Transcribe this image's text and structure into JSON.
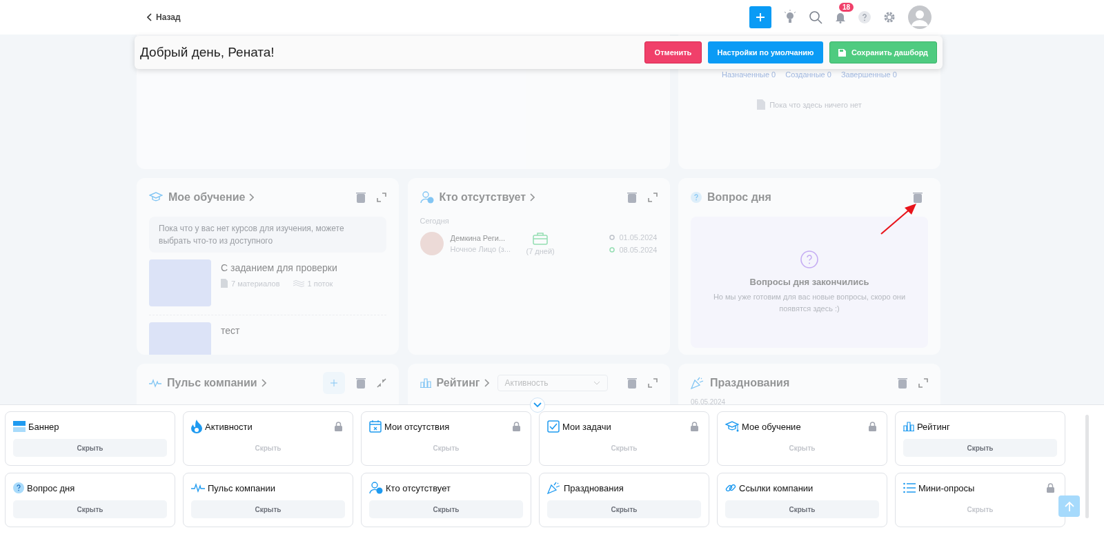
{
  "header": {
    "back_label": "Назад",
    "notifications_count": "18"
  },
  "greeting_bar": {
    "text": "Добрый день, Рената!",
    "buttons": [
      {
        "label": "Отменить",
        "kind": "danger"
      },
      {
        "label": "Настройки по умолчанию",
        "kind": "primary"
      },
      {
        "label": "Сохранить дашборд",
        "kind": "success"
      }
    ]
  },
  "tasks_card": {
    "tabs": [
      {
        "label": "Назначенные",
        "count": "0"
      },
      {
        "label": "Созданные",
        "count": "0"
      },
      {
        "label": "Завершенные",
        "count": "0"
      }
    ],
    "empty_text": "Пока что здесь ничего нет"
  },
  "learning_card": {
    "title": "Мое обучение",
    "info_text": "Пока что у вас нет курсов для изучения, можете выбрать что-то из доступного",
    "courses": [
      {
        "title": "С заданием для проверки",
        "materials": "7 материалов",
        "streams": "1 поток"
      },
      {
        "title": "тест"
      }
    ]
  },
  "absence_card": {
    "title": "Кто отсутствует",
    "section_label": "Сегодня",
    "entries": [
      {
        "name": "Демкина Реги...",
        "subtitle": "Ночное Лицо (з...",
        "duration": "(7 дней)",
        "start_date": "01.05.2024",
        "end_date": "08.05.2024"
      }
    ]
  },
  "question_card": {
    "title": "Вопрос дня",
    "empty_title": "Вопросы дня закончились",
    "empty_text": "Но мы уже готовим для вас новые вопросы, скоро они появятся здесь :)"
  },
  "pulse_card": {
    "title": "Пульс компании"
  },
  "rating_card": {
    "title": "Рейтинг",
    "select_value": "Активность"
  },
  "celebrations_card": {
    "title": "Празднования",
    "date": "06.05.2024"
  },
  "widget_panel": {
    "widgets": [
      {
        "title": "Баннер",
        "kind": "banner",
        "locked": false,
        "button_label": "Скрыть"
      },
      {
        "title": "Активности",
        "kind": "fire",
        "locked": true,
        "button_label": "Скрыть"
      },
      {
        "title": "Мои отсутствия",
        "kind": "calendar",
        "locked": true,
        "button_label": "Скрыть"
      },
      {
        "title": "Мои задачи",
        "kind": "check",
        "locked": true,
        "button_label": "Скрыть"
      },
      {
        "title": "Мое обучение",
        "kind": "cap",
        "locked": true,
        "button_label": "Скрыть"
      },
      {
        "title": "Рейтинг",
        "kind": "bars",
        "locked": false,
        "button_label": "Скрыть"
      },
      {
        "title": "Вопрос дня",
        "kind": "question",
        "locked": false,
        "button_label": "Скрыть"
      },
      {
        "title": "Пульс компании",
        "kind": "pulse",
        "locked": false,
        "button_label": "Скрыть"
      },
      {
        "title": "Кто отсутствует",
        "kind": "user",
        "locked": false,
        "button_label": "Скрыть"
      },
      {
        "title": "Празднования",
        "kind": "party",
        "locked": false,
        "button_label": "Скрыть"
      },
      {
        "title": "Ссылки компании",
        "kind": "link",
        "locked": false,
        "button_label": "Скрыть"
      },
      {
        "title": "Мини-опросы",
        "kind": "list",
        "locked": true,
        "button_label": "Скрыть"
      }
    ]
  }
}
